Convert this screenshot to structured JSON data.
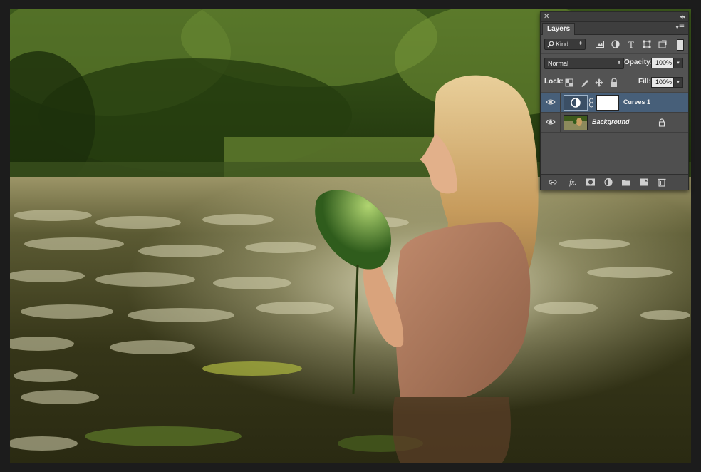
{
  "panel": {
    "tab_label": "Layers",
    "filter": {
      "kind_label": "Kind"
    },
    "blend_mode": "Normal",
    "opacity_label": "Opacity:",
    "opacity_value": "100%",
    "lock_label": "Lock:",
    "fill_label": "Fill:",
    "fill_value": "100%"
  },
  "layers": [
    {
      "name": "Curves 1",
      "type": "adjustment",
      "selected": true,
      "visible": true
    },
    {
      "name": "Background",
      "type": "image",
      "selected": false,
      "visible": true,
      "locked": true
    }
  ],
  "colors": {
    "panel_bg": "#535353",
    "selected_layer": "#475f79",
    "canvas_frame": "#1c1c1c"
  },
  "icons": [
    "close-icon",
    "collapse-icon",
    "panel-menu-icon",
    "search-icon",
    "filter-pixel-icon",
    "filter-adjustment-icon",
    "filter-type-icon",
    "filter-shape-icon",
    "filter-smart-object-icon",
    "filter-toggle-icon",
    "lock-transparent-icon",
    "lock-paint-icon",
    "lock-position-icon",
    "lock-all-icon",
    "eye-icon",
    "chain-link-icon",
    "lock-icon",
    "link-layers-icon",
    "fx-icon",
    "add-mask-icon",
    "new-adjustment-icon",
    "new-group-icon",
    "new-layer-icon",
    "trash-icon"
  ]
}
